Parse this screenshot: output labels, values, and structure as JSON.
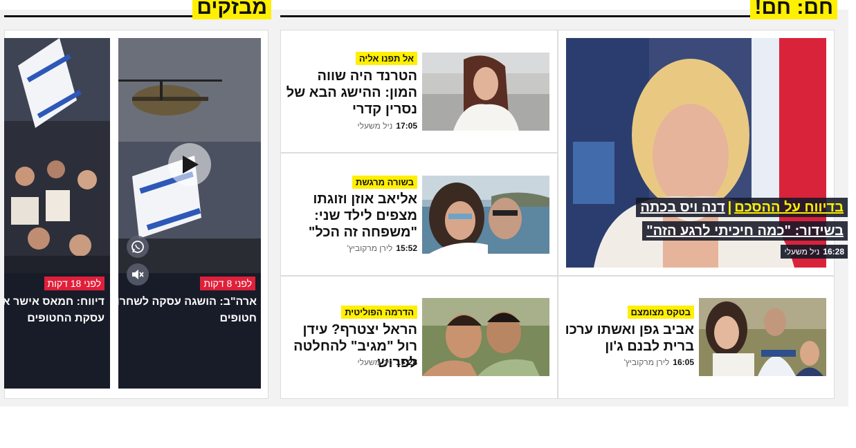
{
  "sections": {
    "hot_title": "חם: חם!",
    "reels_title": "מבזקים"
  },
  "hero": {
    "caption_tag": "בדיווח על ההסכם",
    "caption_line1_rest": "דנה ויס בכתה",
    "caption_line2_prefix": "בשידור: ",
    "caption_line2_quote": "\"כמה חיכיתי לרגע הזה\"",
    "time": "16:28",
    "author": "ניל משעלי"
  },
  "articles": [
    {
      "tag": "אל תפנו אליה",
      "headline": "הטרנד היה שווה המון: ההישג הבא של נסרין קדרי",
      "time": "17:05",
      "author": "ניל משעלי"
    },
    {
      "tag": "בשורה מרגשת",
      "headline": "אליאב אוזן וזוגתו מצפים לילד שני: \"משפחה זה הכל\"",
      "time": "15:52",
      "author": "לירן מרקוביץ'"
    },
    {
      "tag": "הדרמה הפוליטית",
      "headline": "הראל יצטרף? עידן רול \"מגיב\" להחלטה לפרוש",
      "time": "17:28",
      "author": "ניל משעלי"
    },
    {
      "tag": "בטקס מצומצם",
      "headline": "אביב גפן ואשתו ערכו ברית לבנם ג'ון",
      "time": "16:05",
      "author": "לירן מרקוביץ'"
    }
  ],
  "videos": [
    {
      "ago": "לפני 8 דקות",
      "title_line1": "ארה\"ב: הושגה עסקה לשחרור",
      "title_line2": "חטופים"
    },
    {
      "ago": "לפני 18 דקות",
      "title_line1": "דיווח: חמאס אישר את ה",
      "title_line2": "עסקת החטופים"
    }
  ],
  "icons": [
    "play-icon",
    "whatsapp-icon",
    "mute-icon"
  ],
  "colors": {
    "accent_yellow": "#ffef00",
    "badge_red": "#e0203a",
    "dark_card": "#181c28"
  }
}
